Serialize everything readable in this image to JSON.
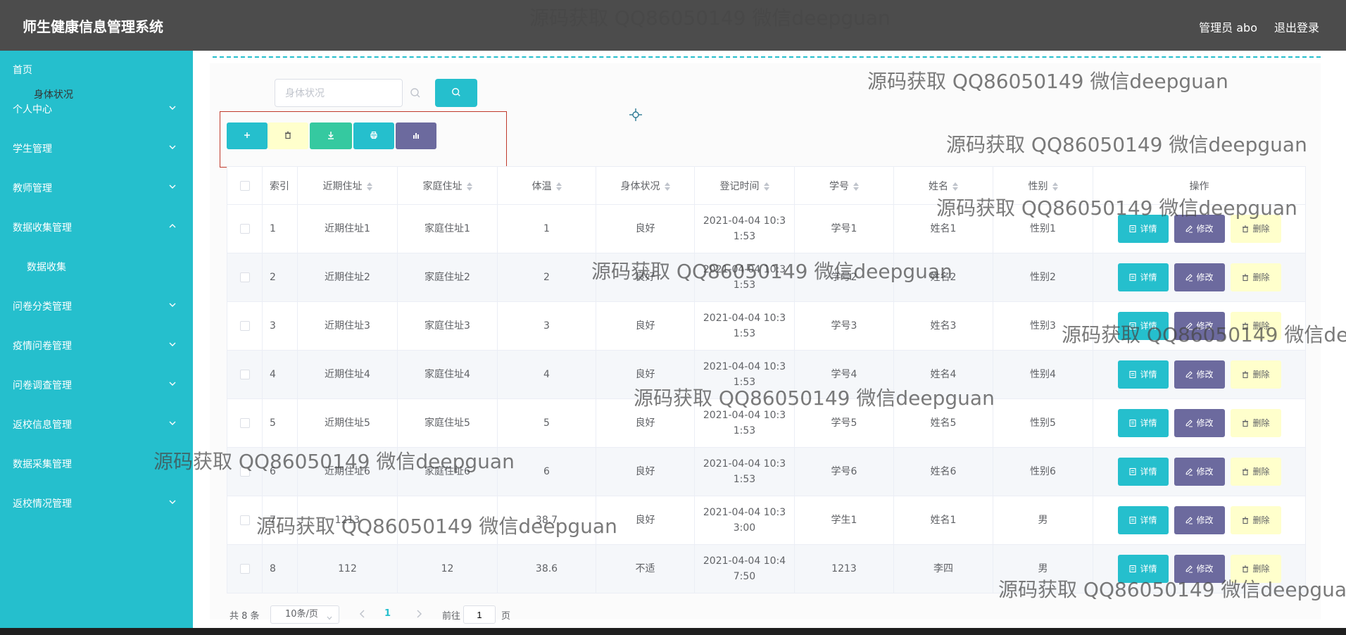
{
  "app_title": "师生健康信息管理系统",
  "header": {
    "user_label": "管理员 abo",
    "logout": "退出登录"
  },
  "sidebar": {
    "items": [
      {
        "label": "首页",
        "chevron": ""
      },
      {
        "label": "个人中心",
        "chevron": "down"
      },
      {
        "label": "学生管理",
        "chevron": "down"
      },
      {
        "label": "教师管理",
        "chevron": "down"
      },
      {
        "label": "数据收集管理",
        "chevron": "up"
      },
      {
        "label": "数据收集",
        "chevron": "",
        "sub": true
      },
      {
        "label": "问卷分类管理",
        "chevron": "down"
      },
      {
        "label": "疫情问卷管理",
        "chevron": "down"
      },
      {
        "label": "问卷调查管理",
        "chevron": "down"
      },
      {
        "label": "返校信息管理",
        "chevron": "down"
      },
      {
        "label": "数据采集管理",
        "chevron": ""
      },
      {
        "label": "返校情况管理",
        "chevron": "down"
      }
    ]
  },
  "search": {
    "label": "身体状况",
    "placeholder": "身体状况",
    "value": ""
  },
  "toolbar": {
    "buttons": [
      {
        "name": "add-button",
        "icon": "plus-icon",
        "color": "#25bfcd"
      },
      {
        "name": "batch-delete-button",
        "icon": "trash-icon",
        "color": "#ffffcc"
      },
      {
        "name": "export-button",
        "icon": "download-icon",
        "color": "#35c9a0"
      },
      {
        "name": "print-button",
        "icon": "print-icon",
        "color": "#25bfcd"
      },
      {
        "name": "chart-button",
        "icon": "bar-chart-icon",
        "color": "#6c6a9e"
      }
    ]
  },
  "table": {
    "headers": [
      "索引",
      "近期住址",
      "家庭住址",
      "体温",
      "身体状况",
      "登记时间",
      "学号",
      "姓名",
      "性别",
      "操作"
    ],
    "rows": [
      {
        "idx": "1",
        "recent": "近期住址1",
        "home": "家庭住址1",
        "temp": "1",
        "health": "良好",
        "time1": "2021-04-04 10:3",
        "time2": "1:53",
        "sid": "学号1",
        "name": "姓名1",
        "gender": "性别1"
      },
      {
        "idx": "2",
        "recent": "近期住址2",
        "home": "家庭住址2",
        "temp": "2",
        "health": "良好",
        "time1": "2021-04-04 10:3",
        "time2": "1:53",
        "sid": "学号2",
        "name": "姓名2",
        "gender": "性别2"
      },
      {
        "idx": "3",
        "recent": "近期住址3",
        "home": "家庭住址3",
        "temp": "3",
        "health": "良好",
        "time1": "2021-04-04 10:3",
        "time2": "1:53",
        "sid": "学号3",
        "name": "姓名3",
        "gender": "性别3"
      },
      {
        "idx": "4",
        "recent": "近期住址4",
        "home": "家庭住址4",
        "temp": "4",
        "health": "良好",
        "time1": "2021-04-04 10:3",
        "time2": "1:53",
        "sid": "学号4",
        "name": "姓名4",
        "gender": "性别4"
      },
      {
        "idx": "5",
        "recent": "近期住址5",
        "home": "家庭住址5",
        "temp": "5",
        "health": "良好",
        "time1": "2021-04-04 10:3",
        "time2": "1:53",
        "sid": "学号5",
        "name": "姓名5",
        "gender": "性别5"
      },
      {
        "idx": "6",
        "recent": "近期住址6",
        "home": "家庭住址6",
        "temp": "6",
        "health": "良好",
        "time1": "2021-04-04 10:3",
        "time2": "1:53",
        "sid": "学号6",
        "name": "姓名6",
        "gender": "性别6"
      },
      {
        "idx": "7",
        "recent": "1213",
        "home": "",
        "temp": "38.7",
        "health": "良好",
        "time1": "2021-04-04 10:3",
        "time2": "3:00",
        "sid": "学生1",
        "name": "姓名1",
        "gender": "男"
      },
      {
        "idx": "8",
        "recent": "112",
        "home": "12",
        "temp": "38.6",
        "health": "不适",
        "time1": "2021-04-04 10:4",
        "time2": "7:50",
        "sid": "1213",
        "name": "李四",
        "gender": "男"
      }
    ],
    "actions": {
      "detail": "详情",
      "edit": "修改",
      "delete": "删除"
    }
  },
  "pagination": {
    "total": "共 8 条",
    "page_size": "10条/页",
    "current": "1",
    "goto_prefix": "前往",
    "goto_value": "1",
    "goto_suffix": "页"
  },
  "watermark": "源码获取 QQ86050149 微信deepguan",
  "colors": {
    "accent": "#25bfcd",
    "edit": "#6c6a9e",
    "delete": "#ffffcc",
    "export": "#35c9a0",
    "header": "#4c4c4c"
  }
}
